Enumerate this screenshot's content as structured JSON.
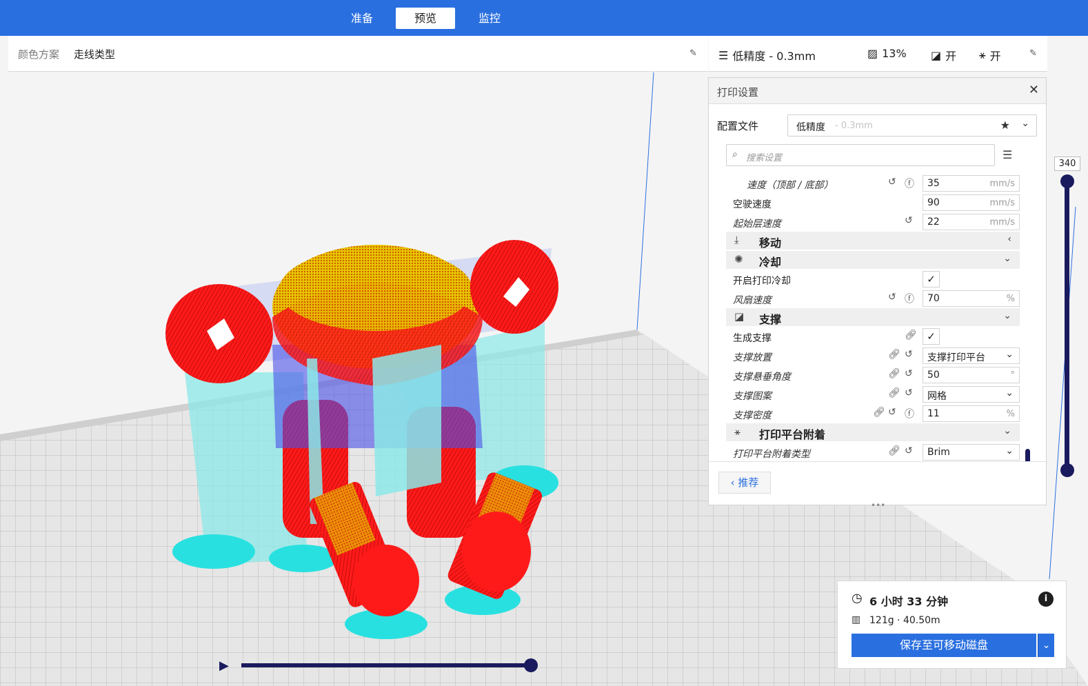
{
  "stages": {
    "prepare": "准备",
    "preview": "预览",
    "monitor": "监控"
  },
  "color_scheme": {
    "label": "颜色方案",
    "value": "走线类型"
  },
  "summary": {
    "profile": "低精度 - 0.3mm",
    "infill": "13%",
    "support": "开",
    "adhesion": "开"
  },
  "panel": {
    "title": "打印设置",
    "profile_label": "配置文件",
    "profile_name": "低精度",
    "profile_sub": "- 0.3mm",
    "search_placeholder": "搜索设置",
    "recommend_label": "推荐"
  },
  "settings": {
    "speed_topbottom": {
      "label": "速度（顶部 / 底部）",
      "value": "35",
      "unit": "mm/s"
    },
    "travel_speed": {
      "label": "空驶速度",
      "value": "90",
      "unit": "mm/s"
    },
    "initial_layer_speed": {
      "label": "起始层速度",
      "value": "22",
      "unit": "mm/s"
    },
    "cat_travel": "移动",
    "cat_cooling": "冷却",
    "enable_cooling": {
      "label": "开启打印冷却",
      "checked": "✓"
    },
    "fan_speed": {
      "label": "风扇速度",
      "value": "70",
      "unit": "%"
    },
    "cat_support": "支撑",
    "generate_support": {
      "label": "生成支撑",
      "checked": "✓"
    },
    "support_placement": {
      "label": "支撑放置",
      "value": "支撑打印平台"
    },
    "support_angle": {
      "label": "支撑悬垂角度",
      "value": "50",
      "unit": "°"
    },
    "support_pattern": {
      "label": "支撑图案",
      "value": "网格"
    },
    "support_density": {
      "label": "支撑密度",
      "value": "11",
      "unit": "%"
    },
    "cat_adhesion": "打印平台附着",
    "adhesion_type": {
      "label": "打印平台附着类型",
      "value": "Brim"
    }
  },
  "layer_slider": {
    "value": "340"
  },
  "output": {
    "time": "6 小时 33 分钟",
    "material": "121g · 40.50m",
    "save_label": "保存至可移动磁盘"
  },
  "colors": {
    "accent": "#2a6fe0",
    "slider": "#1a1a5e",
    "support": "#7fe6e6",
    "wall": "#ff2020",
    "skin": "#ffd400"
  }
}
